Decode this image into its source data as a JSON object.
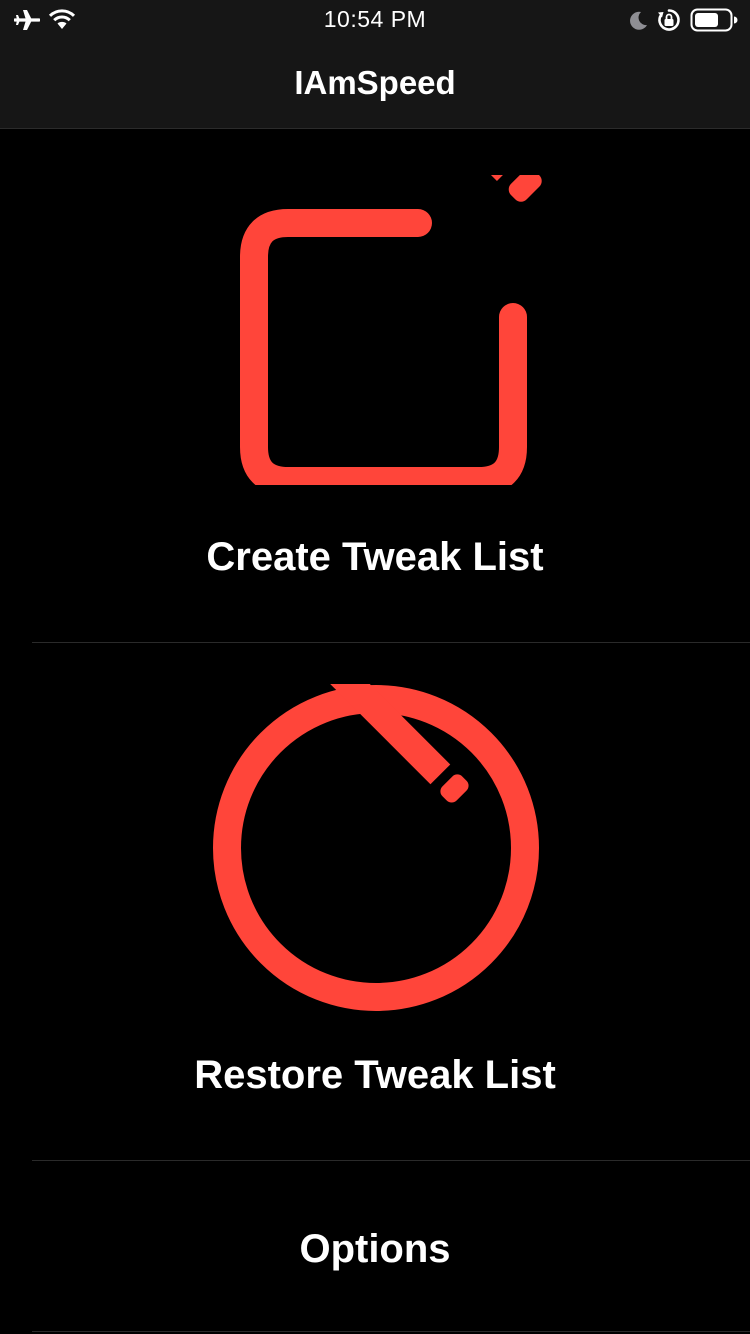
{
  "status_bar": {
    "time": "10:54 PM",
    "icons": [
      "airplane-icon",
      "wifi-icon",
      "moon-icon",
      "rotation-lock-icon",
      "battery-icon"
    ]
  },
  "nav": {
    "title": "IAmSpeed"
  },
  "menu": {
    "create_label": "Create Tweak List",
    "create_icon": "square-and-pencil-icon",
    "restore_label": "Restore Tweak List",
    "restore_icon": "pencil-circle-icon",
    "options_label": "Options"
  },
  "colors": {
    "accent": "#FF453A",
    "background": "#000000",
    "bar": "#161616",
    "text": "#FFFFFF"
  }
}
